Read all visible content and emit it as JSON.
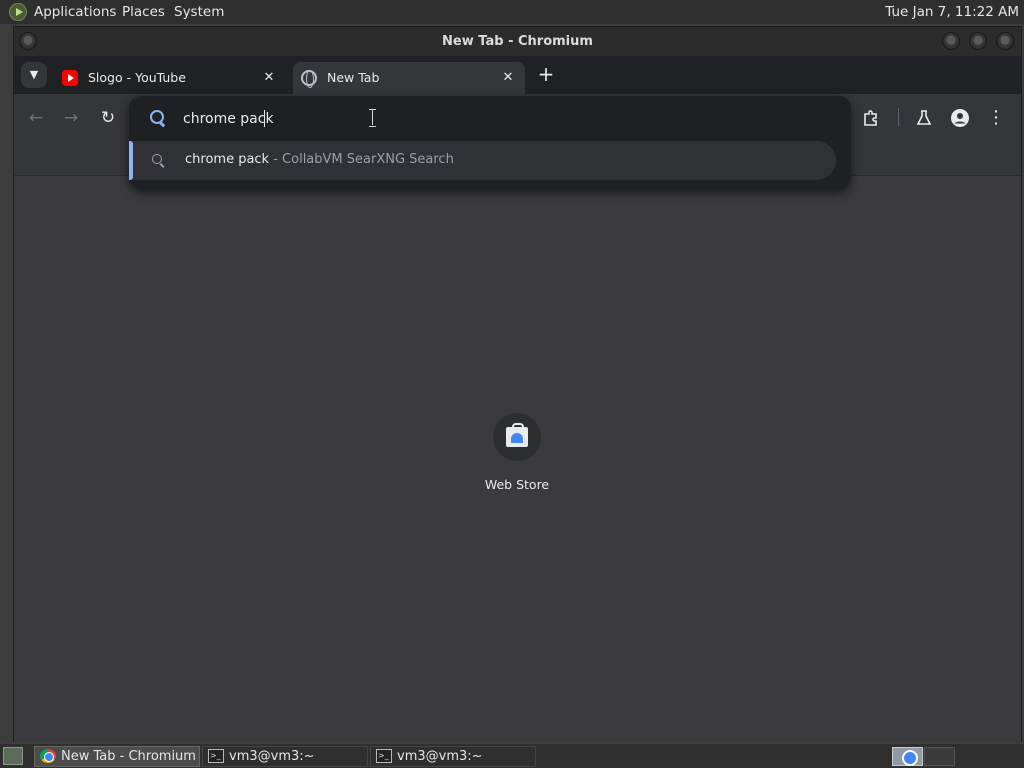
{
  "panel": {
    "menus": [
      "Applications",
      "Places",
      "System"
    ],
    "clock": "Tue Jan  7, 11:22 AM"
  },
  "window": {
    "title": "New Tab - Chromium"
  },
  "tabs": [
    {
      "label": "Slogo - YouTube",
      "favicon": "youtube-icon",
      "active": false
    },
    {
      "label": "New Tab",
      "favicon": "globe-icon",
      "active": true
    }
  ],
  "omnibox": {
    "value": "chrome pack",
    "suggestions": [
      {
        "text": "chrome pack",
        "description": " - CollabVM SearXNG Search",
        "icon": "search-icon"
      }
    ]
  },
  "toolbar": {
    "icons": [
      "back-icon",
      "forward-icon",
      "reload-icon",
      "extensions-icon",
      "labs-icon",
      "profile-icon",
      "menu-icon"
    ]
  },
  "shortcuts": [
    {
      "label": "Web Store",
      "icon": "web-store-icon"
    }
  ],
  "taskbar": {
    "tasks": [
      {
        "label": "New Tab - Chromium",
        "icon": "chromium-icon",
        "active": true
      },
      {
        "label": "vm3@vm3:~",
        "icon": "terminal-icon",
        "active": false
      },
      {
        "label": "vm3@vm3:~",
        "icon": "terminal-icon",
        "active": false
      }
    ]
  },
  "colors": {
    "accent": "#8ab4f8",
    "page_background": "#3b3b3e",
    "toolbar": "#35363a",
    "tabstrip": "#202124"
  }
}
